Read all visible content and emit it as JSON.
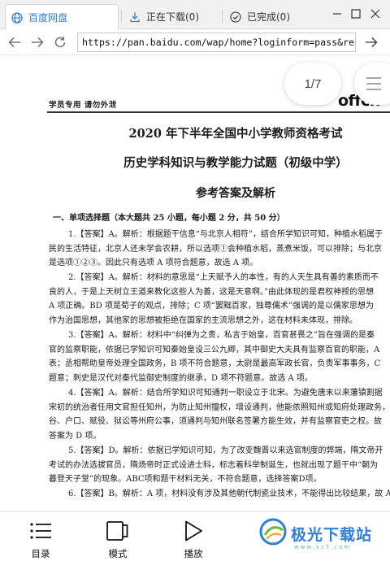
{
  "tabs": [
    {
      "label": "百度网盘",
      "icon": "globe-icon"
    },
    {
      "label": "正在下载(0)",
      "icon": "download-icon"
    },
    {
      "label": "已完成(0)",
      "icon": "check-circle-icon"
    }
  ],
  "address_bar": {
    "url": "https://pan.baidu.com/wap/home?loginform=pass&realN"
  },
  "document": {
    "header_left": "学员专用  请勿外泄",
    "header_logo": "offcn",
    "title_1": "2020 年下半年全国中小学教师资格考试",
    "title_2": "历史学科知识与教学能力试题（初级中学）",
    "title_3": "参考答案及解析",
    "section": "一、单项选择题（本大题共 25 小题，每小题 2 分，共 50 分）",
    "paragraphs": [
      [
        "1.【答案】A。解析：根据题干信息“与北京人相符”，结合所学知识可知，种植水稻属于",
        "民的生活特征，北京人还未学会农耕，所以选项①会种植水稻，蒸煮米饭，可以排除；与北京",
        "是选项①②③。因此只有选项 A 项符合题意，故选 A 项。"
      ],
      [
        "2.【答案】A。解析：材料的意思是“上天赋予人的本性，有的人天生具有善的素质而不",
        "良的人，于是上天树立王道来教化这些人为善，这是天意啊。”由此体现的是君权神授的思想",
        "A 项正确。BD 项是荀子的观点，排除；C 项“罢黜百家，独尊儒术”强调的是以儒家思想为",
        "作为治国思想，其他家的思想被拒绝在国家的主流思想之外，这在材料未体现，排除。"
      ],
      [
        "3.【答案】A。解析：材料中“纠弹为之责，私言于始皇，百官甚畏之”旨在强调的是秦",
        "官的监察职能，依据已学知识可知秦始皇设三公九卿，其中御史大夫具有监察百官的职能，A",
        "表；丞相帮助皇帝处理全国政务，B 项不符合题意，太尉是最高军政长官，负责军事事务，C",
        "题意；刺史是汉代对秦代监御史制度的继承，D 项不符题意。故选 A 项。"
      ],
      [
        "4.【答案】A。解析：结合所学知识可知通判一职设立于北宋。为避免唐末以来藩镇割据",
        "宋初的统治者任用文官担任知州，为防止知州擅权，增设通判，他能依照知州或知府处理政务，凡",
        "谷、户口、赋役、狱讼等州府公事，须通判与知州联名签署方能生效，并有监察官吏之权。故",
        "答案为 D 项。"
      ],
      [
        "5.【答案】D。解析：依据已学知识可知，为了改变魏晋以来选官制度的弊端，隋文帝开",
        "考试的办法选拔官员，隋炀帝时正式设进士科，标志着科举制诞生，也就出现了题干中“朝为",
        "暮登天子堂”的现象。ABC项和题干材料无关，不符合题意，选择答案D项。"
      ],
      [
        "6.【答案】B。解析：A 项，材料没有涉及其他朝代制瓷业技术，不能得出比较结果，故 A"
      ]
    ]
  },
  "page_indicator": "1/7",
  "bottom_bar": {
    "items": [
      {
        "label": "目录",
        "icon": "list-icon"
      },
      {
        "label": "模式",
        "icon": "mode-icon"
      },
      {
        "label": "播放",
        "icon": "play-icon"
      }
    ]
  },
  "watermark": {
    "text": "极光下载站",
    "sub": "www.xz7.com"
  },
  "colors": {
    "accent": "#3a7bd5",
    "tab_bar": "#f1f1f1",
    "watermark": "#2f7ed8"
  }
}
